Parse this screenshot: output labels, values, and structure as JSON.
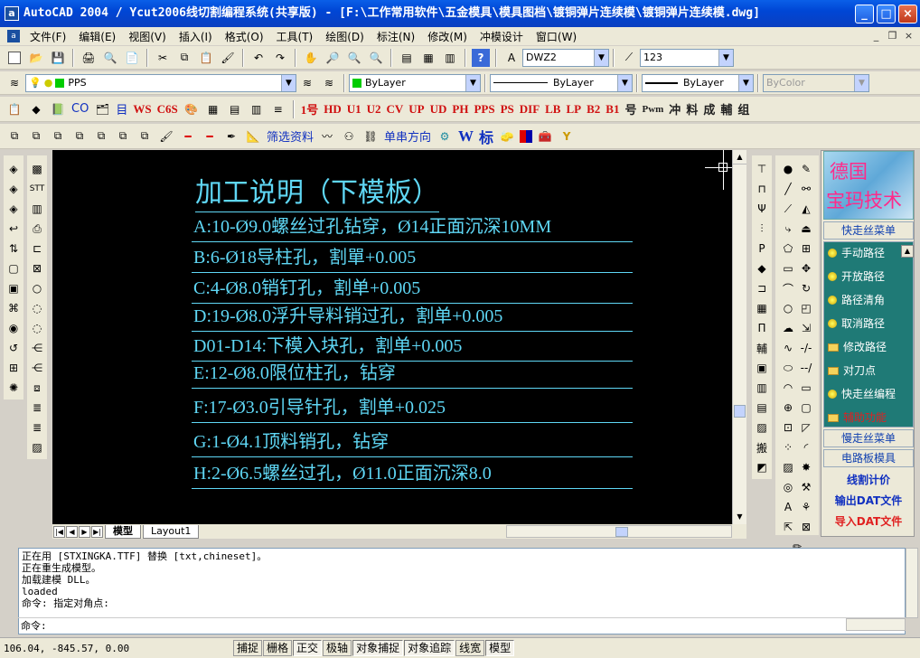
{
  "window": {
    "title": "AutoCAD 2004 / Ycut2006线切割编程系统(共享版) - [F:\\工作常用软件\\五金模具\\模具图档\\镀铜弹片连续模\\镀铜弹片连续模.dwg]",
    "app_icon": "a",
    "min": "_",
    "max": "□",
    "close": "×"
  },
  "menu": [
    "文件(F)",
    "编辑(E)",
    "视图(V)",
    "插入(I)",
    "格式(O)",
    "工具(T)",
    "绘图(D)",
    "标注(N)",
    "修改(M)",
    "冲模设计",
    "窗口(W)"
  ],
  "mdi": {
    "min": "_",
    "restore": "❐",
    "close": "×"
  },
  "toolbar1": {
    "style_combo": "DWZ2",
    "dim_combo": "123"
  },
  "toolbar2": {
    "layer_combo": "PPS",
    "color_combo": "ByLayer",
    "linetype_combo": "ByLayer",
    "lineweight_combo": "ByLayer",
    "plotstyle_combo": "ByColor"
  },
  "toolbar3": {
    "labels": [
      "CO",
      "目",
      "WS",
      "C6S",
      "1号",
      "HD",
      "U1",
      "U2",
      "CV",
      "UP",
      "UD",
      "PH",
      "PPS",
      "PS",
      "DIF",
      "LB",
      "LP",
      "B2",
      "B1",
      "号",
      "Pwm",
      "冲",
      "料",
      "成",
      "輔",
      "组"
    ]
  },
  "toolbar4": {
    "filter": "筛选资料",
    "direction": "单串方向",
    "w": "W",
    "biao": "标"
  },
  "drawing": {
    "title": "加工说明（下模板）",
    "notes": [
      "A:10-Ø9.0螺丝过孔钻穿，Ø14正面沉深10MM",
      "B:6-Ø18导柱孔，割單+0.005",
      "C:4-Ø8.0销钉孔，割单+0.005",
      "D:19-Ø8.0浮升导料销过孔，割单+0.005",
      "D01-D14:下模入块孔，割单+0.005",
      "E:12-Ø8.0限位柱孔，钻穿",
      "F:17-Ø3.0引导针孔，割单+0.025",
      "G:1-Ø4.1顶料销孔，钻穿",
      "H:2-Ø6.5螺丝过孔，Ø11.0正面沉深8.0"
    ]
  },
  "tabs": {
    "model": "模型",
    "layout": "Layout1"
  },
  "panel": {
    "logo_line1": "德国",
    "logo_line2": "宝玛技术",
    "fast_menu": "快走丝菜单",
    "items": [
      "手动路径",
      "开放路径",
      "路径清角",
      "取消路径",
      "修改路径",
      "对刀点",
      "快走丝编程",
      "辅助功能"
    ],
    "slow_menu": "慢走丝菜单",
    "electrode": "电路板模具",
    "price": "线割计价",
    "export": "输出DAT文件",
    "import": "导入DAT文件"
  },
  "command": {
    "lines": [
      "正在用 [STXINGKA.TTF] 替换 [txt,chineset]。",
      "正在重生成模型。",
      "加载建模 DLL。",
      "loaded",
      "命令: 指定对角点:"
    ],
    "prompt": "命令:"
  },
  "status": {
    "coords": "106.04, -845.57, 0.00",
    "buttons": [
      "捕捉",
      "栅格",
      "正交",
      "极轴",
      "对象捕捉",
      "对象追踪",
      "线宽",
      "模型"
    ]
  },
  "colors": {
    "drawing_text": "#5fd7f5",
    "canvas": "#000000",
    "panel": "#1f7a76"
  }
}
